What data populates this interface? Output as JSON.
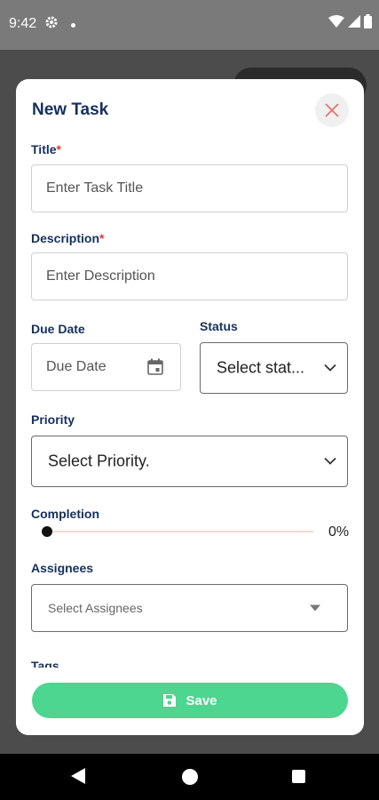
{
  "status_bar": {
    "time": "9:42"
  },
  "dialog": {
    "title": "New Task",
    "fields": {
      "title": {
        "label": "Title",
        "required_mark": "*",
        "placeholder": "Enter Task Title"
      },
      "description": {
        "label": "Description",
        "required_mark": "*",
        "placeholder": "Enter Description"
      },
      "due_date": {
        "label": "Due Date",
        "placeholder": "Due Date"
      },
      "status": {
        "label": "Status",
        "value": "Select stat..."
      },
      "priority": {
        "label": "Priority",
        "value": "Select Priority."
      },
      "completion": {
        "label": "Completion",
        "value_text": "0%",
        "value": 0
      },
      "assignees": {
        "label": "Assignees",
        "placeholder": "Select Assignees"
      },
      "tags": {
        "label": "Tags"
      }
    },
    "save_label": "Save"
  },
  "colors": {
    "accent_title": "#16305c",
    "required": "#e03a3a",
    "save_button": "#4cd690"
  }
}
